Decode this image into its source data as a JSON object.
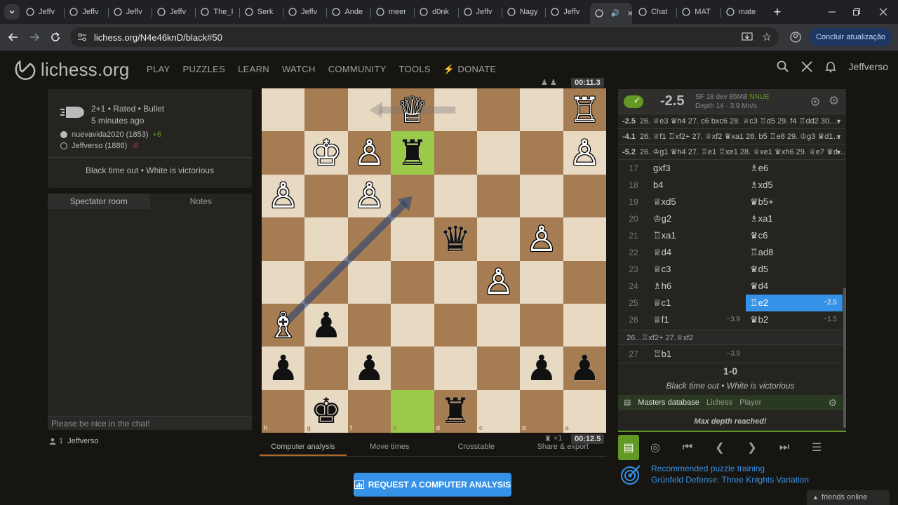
{
  "browser": {
    "tabs": [
      {
        "label": "Jeffv"
      },
      {
        "label": "Jeffv"
      },
      {
        "label": "Jeffv"
      },
      {
        "label": "Jeffv"
      },
      {
        "label": "The_I"
      },
      {
        "label": "Serk"
      },
      {
        "label": "Jeffv"
      },
      {
        "label": "Ande"
      },
      {
        "label": "meer"
      },
      {
        "label": "d0nk"
      },
      {
        "label": "Jeffv"
      },
      {
        "label": "Nagy"
      },
      {
        "label": "Jeffv"
      },
      {
        "label": ""
      },
      {
        "label": "Chat"
      },
      {
        "label": "MAT"
      },
      {
        "label": "mate"
      }
    ],
    "url": "lichess.org/N4e46knD/black#50",
    "update_label": "Concluir atualização"
  },
  "site": {
    "logo": "lichess.org",
    "nav": [
      "PLAY",
      "PUZZLES",
      "LEARN",
      "WATCH",
      "COMMUNITY",
      "TOOLS",
      "DONATE"
    ],
    "username": "Jeffverso"
  },
  "game": {
    "type": "2+1 • Rated • Bullet",
    "time_ago": "5 minutes ago",
    "white_player": "nuevavida2020 (1853)",
    "white_diff": "+6",
    "black_player": "Jeffverso (1886)",
    "black_diff": "-6",
    "status": "Black time out • White is victorious"
  },
  "chat": {
    "tab_spectator": "Spectator room",
    "tab_notes": "Notes",
    "placeholder": "Please be nice in the chat!",
    "viewers_count": "1",
    "viewer": "Jeffverso"
  },
  "board": {
    "top_clock": "00:11.3",
    "bottom_clock": "00:12.5",
    "bottom_material": "+1",
    "ranks": [
      "1",
      "2",
      "3",
      "4",
      "5",
      "6",
      "7",
      "8"
    ],
    "files": [
      "h",
      "g",
      "f",
      "e",
      "d",
      "c",
      "b",
      "a"
    ],
    "colors": {
      "light": "#e8d9c3",
      "dark": "#a67c52",
      "highlight": "#9bc94a"
    },
    "pieces": [
      {
        "sq": "e1",
        "glyph": "♕",
        "color": "w"
      },
      {
        "sq": "a1",
        "glyph": "♖",
        "color": "w"
      },
      {
        "sq": "g2",
        "glyph": "♔",
        "color": "w"
      },
      {
        "sq": "f2",
        "glyph": "♙",
        "color": "w"
      },
      {
        "sq": "e2",
        "glyph": "♜",
        "color": "b"
      },
      {
        "sq": "a2",
        "glyph": "♙",
        "color": "w"
      },
      {
        "sq": "h3",
        "glyph": "♙",
        "color": "w"
      },
      {
        "sq": "f3",
        "glyph": "♙",
        "color": "w"
      },
      {
        "sq": "d4",
        "glyph": "♛",
        "color": "b"
      },
      {
        "sq": "b4",
        "glyph": "♙",
        "color": "w"
      },
      {
        "sq": "c5",
        "glyph": "♙",
        "color": "w"
      },
      {
        "sq": "h6",
        "glyph": "♗",
        "color": "w"
      },
      {
        "sq": "g6",
        "glyph": "♟",
        "color": "b"
      },
      {
        "sq": "h7",
        "glyph": "♟",
        "color": "b"
      },
      {
        "sq": "f7",
        "glyph": "♟",
        "color": "b"
      },
      {
        "sq": "b7",
        "glyph": "♟",
        "color": "b"
      },
      {
        "sq": "a7",
        "glyph": "♟",
        "color": "b"
      },
      {
        "sq": "g8",
        "glyph": "♚",
        "color": "b"
      },
      {
        "sq": "d8",
        "glyph": "♜",
        "color": "b"
      }
    ],
    "highlights": [
      "e2",
      "e8"
    ]
  },
  "under_tabs": [
    "Computer analysis",
    "Move times",
    "Crosstable",
    "Share & export"
  ],
  "request_analysis": "REQUEST A COMPUTER ANALYSIS",
  "analysis": {
    "eval": "-2.5",
    "engine": "SF 18 dev 85MB",
    "engine_tag": "NNUE",
    "depth": "Depth 14 · 3.9 Mn/s",
    "pvs": [
      {
        "eval": "-2.5",
        "line": "26. ♕e3 ♛h4 27. c6 bxc6 28. ♕c3 ♖d5 29. f4 ♖dd2 30.…"
      },
      {
        "eval": "-4.1",
        "line": "26. ♕f1 ♖xf2+ 27. ♕xf2 ♛xa1 28. b5 ♖e8 29. ♔g3 ♛d1…"
      },
      {
        "eval": "-5.2",
        "line": "26. ♔g1 ♛h4 27. ♖e1 ♖xe1 28. ♕xe1 ♛xh6 29. ♕e7 ♛d…"
      }
    ],
    "moves": [
      {
        "n": "17",
        "w": "gxf3",
        "b": "♗e6",
        "we": "",
        "be": ""
      },
      {
        "n": "18",
        "w": "b4",
        "b": "♗xd5",
        "we": "",
        "be": ""
      },
      {
        "n": "19",
        "w": "♕xd5",
        "b": "♛b5+",
        "we": "",
        "be": ""
      },
      {
        "n": "20",
        "w": "♔g2",
        "b": "♗xa1",
        "we": "",
        "be": ""
      },
      {
        "n": "21",
        "w": "♖xa1",
        "b": "♛c6",
        "we": "",
        "be": ""
      },
      {
        "n": "22",
        "w": "♕d4",
        "b": "♖ad8",
        "we": "",
        "be": ""
      },
      {
        "n": "23",
        "w": "♕c3",
        "b": "♛d5",
        "we": "",
        "be": ""
      },
      {
        "n": "24",
        "w": "♗h6",
        "b": "♛d4",
        "we": "",
        "be": ""
      },
      {
        "n": "25",
        "w": "♕c1",
        "b": "♖e2",
        "we": "",
        "be": "−2.5"
      },
      {
        "n": "26",
        "w": "♕f1",
        "b": "♛b2",
        "we": "−3.9",
        "be": "−1.5"
      }
    ],
    "variation": "26...♖xf2+ 27.♕xf2",
    "move27": {
      "n": "27",
      "w": "♖b1",
      "we": "−3.9"
    },
    "result": "1-0",
    "result_status": "Black time out • White is victorious",
    "explorer": [
      "Masters database",
      "Lichess",
      "Player"
    ],
    "max_depth": "Max depth reached!"
  },
  "puzzle": {
    "line1": "Recommended puzzle training",
    "line2": "Grünfeld Defense: Three Knights Variation"
  },
  "friends": "friends online"
}
